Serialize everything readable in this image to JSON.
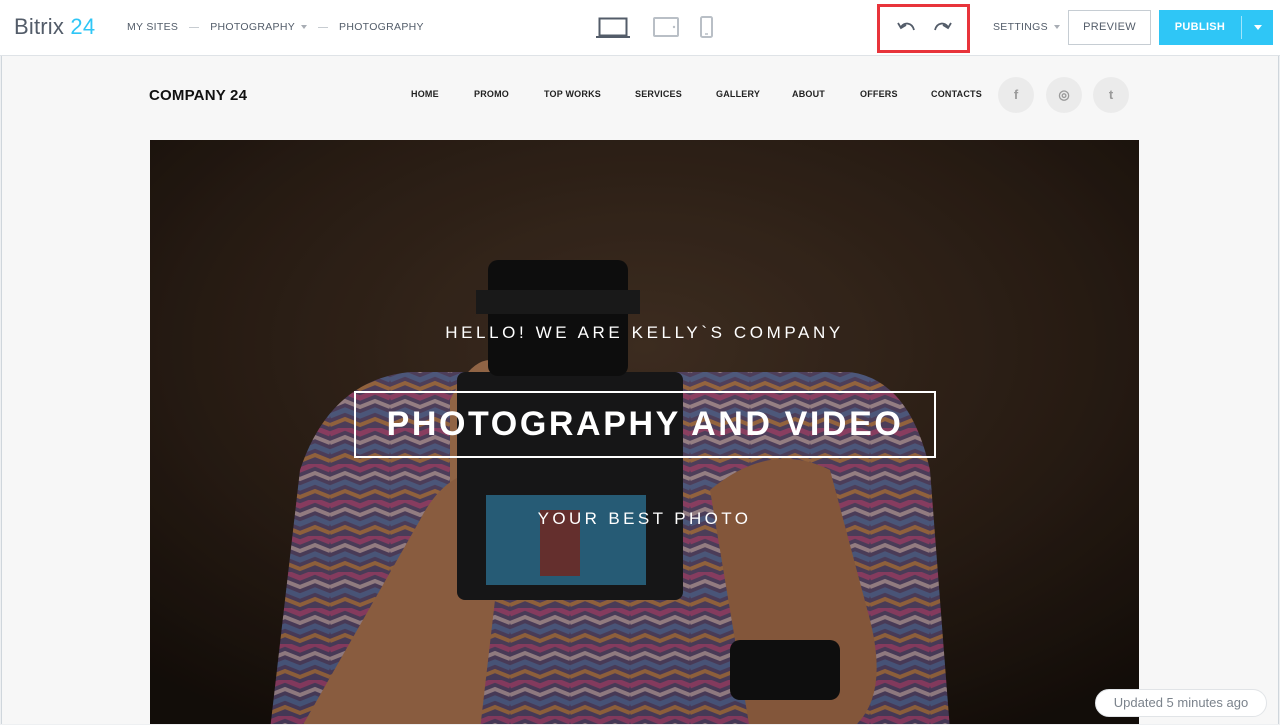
{
  "editor": {
    "logo": {
      "name": "Bitrix",
      "number": "24"
    },
    "breadcrumbs": [
      {
        "label": "MY SITES",
        "dropdown": false
      },
      {
        "label": "PHOTOGRAPHY",
        "dropdown": true
      },
      {
        "label": "PHOTOGRAPHY",
        "dropdown": false
      }
    ],
    "devices": [
      "desktop-icon",
      "tablet-icon",
      "mobile-icon"
    ],
    "active_device": "desktop",
    "history": [
      "undo-icon",
      "redo-icon"
    ],
    "settings_label": "SETTINGS",
    "preview_label": "PREVIEW",
    "publish_label": "PUBLISH",
    "accent_color": "#2fc6f6",
    "highlight_color": "#e8343b",
    "status": "Updated 5 minutes ago"
  },
  "site": {
    "logo": "COMPANY 24",
    "nav": [
      "HOME",
      "PROMO",
      "TOP WORKS",
      "SERVICES",
      "GALLERY",
      "ABOUT",
      "OFFERS",
      "CONTACTS"
    ],
    "social": [
      {
        "icon": "facebook-icon",
        "glyph": "f"
      },
      {
        "icon": "instagram-icon",
        "glyph": "◎"
      },
      {
        "icon": "twitter-icon",
        "glyph": "t"
      }
    ],
    "hero": {
      "subtitle": "HELLO! WE ARE KELLY`S COMPANY",
      "title": "PHOTOGRAPHY AND VIDEO",
      "tagline": "YOUR BEST PHOTO"
    }
  }
}
